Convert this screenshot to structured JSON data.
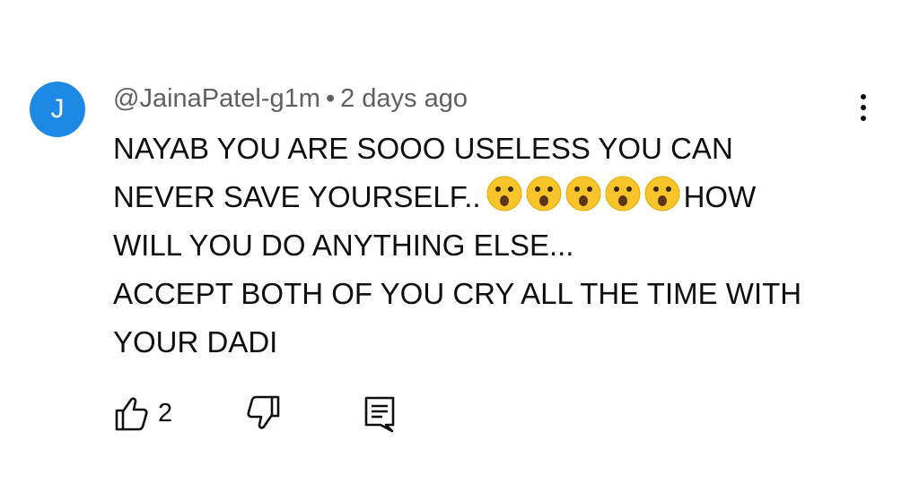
{
  "comment": {
    "avatar_letter": "J",
    "author": "@JainaPatel-g1m",
    "separator": "•",
    "time": "2 days ago",
    "lines": [
      "NAYAB YOU ARE SOOO USELESS YOU CAN",
      "NEVER SAVE YOURSELF..",
      "HOW",
      "WILL YOU DO ANYTHING ELSE...",
      "ACCEPT BOTH OF YOU CRY ALL THE TIME WITH",
      "YOUR DADI"
    ],
    "emoji_name": "astonished-face-icon",
    "emoji_count": 5,
    "like_count": "2"
  },
  "icons": {
    "like": "thumbs-up-icon",
    "dislike": "thumbs-down-icon",
    "reply": "comment-reply-icon",
    "menu": "more-vertical-icon"
  },
  "colors": {
    "avatar_bg": "#1e88e5",
    "meta_text": "#606060",
    "text": "#0f0f0f"
  }
}
